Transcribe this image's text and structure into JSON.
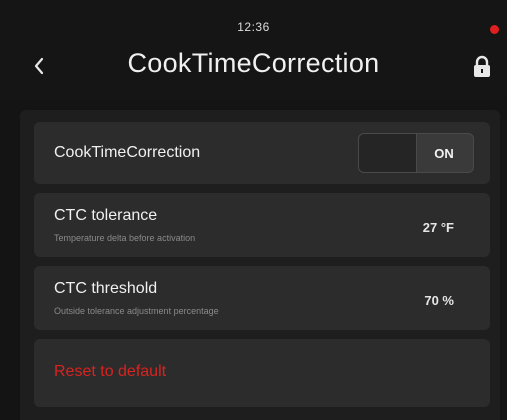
{
  "status_bar": {
    "time": "12:36"
  },
  "header": {
    "title": "CookTimeCorrection"
  },
  "settings": {
    "ctc_toggle": {
      "label": "CookTimeCorrection",
      "state": "ON"
    },
    "tolerance": {
      "label": "CTC tolerance",
      "description": "Temperature delta before activation",
      "value": "27 °F"
    },
    "threshold": {
      "label": "CTC threshold",
      "description": "Outside tolerance adjustment percentage",
      "value": "70 %"
    },
    "reset": {
      "label": "Reset to default"
    }
  },
  "colors": {
    "background": "#141414",
    "row": "#2c2c2c",
    "danger": "#d9231f",
    "status_dot": "#e02020"
  },
  "icons": [
    "chevron-left-icon",
    "lock-icon"
  ]
}
